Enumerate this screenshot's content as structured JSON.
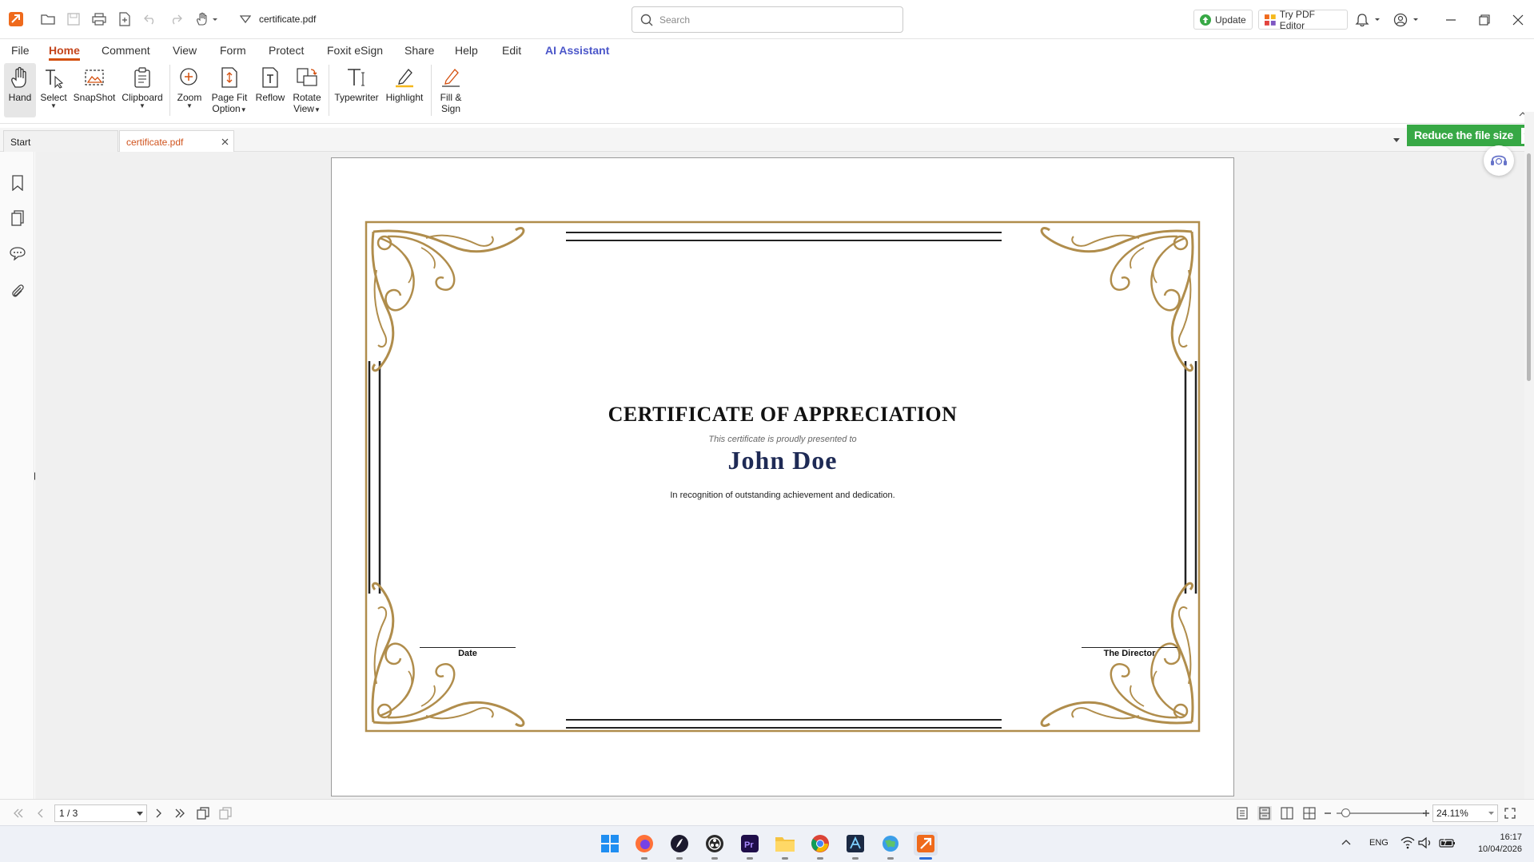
{
  "titlebar": {
    "doc_title": "certificate.pdf",
    "search_placeholder": "Search",
    "update_label": "Update",
    "try_editor_label": "Try PDF Editor"
  },
  "menu": {
    "tabs": [
      "File",
      "Home",
      "Comment",
      "View",
      "Form",
      "Protect",
      "Foxit eSign",
      "Share",
      "Help",
      "Edit",
      "AI Assistant"
    ],
    "active": "Home"
  },
  "ribbon": {
    "hand": "Hand",
    "select": "Select",
    "snapshot": "SnapShot",
    "clipboard": "Clipboard",
    "zoom": "Zoom",
    "page_fit_1": "Page Fit",
    "page_fit_2": "Option",
    "reflow": "Reflow",
    "rotate_1": "Rotate",
    "rotate_2": "View",
    "typewriter": "Typewriter",
    "highlight": "Highlight",
    "fill_1": "Fill &",
    "fill_2": "Sign"
  },
  "tabs": {
    "start": "Start",
    "file": "certificate.pdf",
    "reduce_banner": "Reduce the file size"
  },
  "certificate": {
    "title": "CERTIFICATE OF APPRECIATION",
    "subtitle": "This certificate is proudly presented to",
    "name": "John Doe",
    "recognition": "In recognition of outstanding achievement and dedication.",
    "date_label": "Date",
    "director_label": "The Director"
  },
  "statusbar": {
    "page": "1 / 3",
    "zoom": "24.11%",
    "zoom_level": 0.05
  },
  "taskbar": {
    "lang": "ENG",
    "time": "16:17",
    "date": "10/04/2026"
  },
  "colors": {
    "accent": "#d4500f",
    "ai": "#4b56c9",
    "banner": "#37a845",
    "ornament": "#b08d4c"
  }
}
